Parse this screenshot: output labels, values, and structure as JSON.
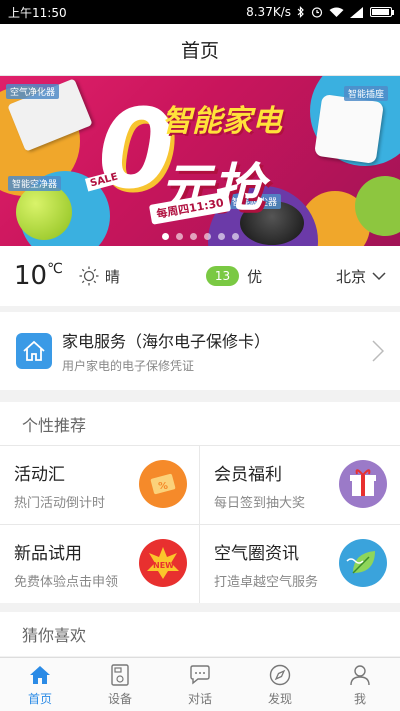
{
  "status": {
    "time": "上午11:50",
    "net_speed": "8.37K/s"
  },
  "header": {
    "title": "首页"
  },
  "banner": {
    "headline": "智能家电",
    "big": "0",
    "headline2": "元抢",
    "sale": "SALE",
    "tag": "每周四11:30",
    "products": [
      "空气净化器",
      "智能插座",
      "智能空净器",
      "智能吸尘器"
    ],
    "slide_count": 6,
    "active_slide": 0
  },
  "weather": {
    "temp": "10",
    "unit": "℃",
    "condition": "晴",
    "aqi_value": "13",
    "aqi_label": "优",
    "city": "北京"
  },
  "service": {
    "title": "家电服务（海尔电子保修卡）",
    "subtitle": "用户家电的电子保修凭证"
  },
  "recommend": {
    "heading": "个性推荐",
    "items": [
      {
        "title": "活动汇",
        "subtitle": "热门活动倒计时",
        "icon": "ticket-icon",
        "color": "#f58a2a"
      },
      {
        "title": "会员福利",
        "subtitle": "每日签到抽大奖",
        "icon": "gift-icon",
        "color": "#9b7ac8"
      },
      {
        "title": "新品试用",
        "subtitle": "免费体验点击申领",
        "icon": "new-product-icon",
        "color": "#e8302f"
      },
      {
        "title": "空气圈资讯",
        "subtitle": "打造卓越空气服务",
        "icon": "leaf-icon",
        "color": "#3aa3dc"
      }
    ]
  },
  "guess": {
    "heading": "猜你喜欢"
  },
  "tabs": [
    {
      "label": "首页",
      "icon": "home-icon",
      "active": true
    },
    {
      "label": "设备",
      "icon": "device-icon",
      "active": false
    },
    {
      "label": "对话",
      "icon": "chat-icon",
      "active": false
    },
    {
      "label": "发现",
      "icon": "compass-icon",
      "active": false
    },
    {
      "label": "我",
      "icon": "person-icon",
      "active": false
    }
  ],
  "colors": {
    "accent": "#2b8be6",
    "aqi_good": "#7ac943",
    "banner": "#d91a63"
  }
}
